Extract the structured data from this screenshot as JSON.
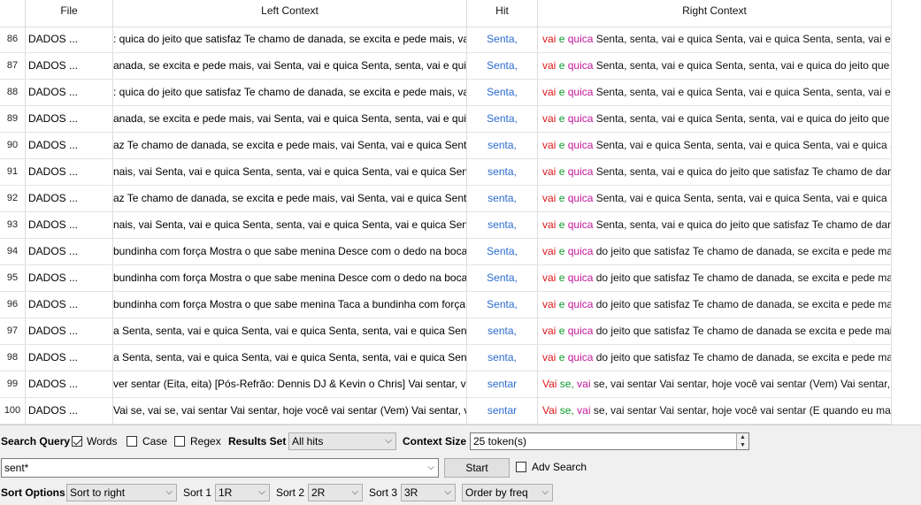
{
  "columns": {
    "file": "File",
    "left": "Left Context",
    "hit": "Hit",
    "right": "Right Context"
  },
  "rows": [
    {
      "num": "86",
      "file": "DADOS ...",
      "left": ": quica do jeito que satisfaz Te chamo de danada, se excita e pede mais, vai",
      "hit": "Senta,",
      "r1": "vai",
      "r2": "e",
      "r3": "quica",
      "rest": "Senta, senta, vai e quica Senta, vai e quica Senta, senta, vai e quica"
    },
    {
      "num": "87",
      "file": "DADOS ...",
      "left": "anada, se excita e pede mais, vai Senta, vai e quica Senta, senta, vai e quica",
      "hit": "Senta,",
      "r1": "vai",
      "r2": "e",
      "r3": "quica",
      "rest": "Senta, senta, vai e quica Senta, senta, vai e quica do jeito que satisfaz"
    },
    {
      "num": "88",
      "file": "DADOS ...",
      "left": ": quica do jeito que satisfaz Te chamo de danada, se excita e pede mais, vai",
      "hit": "Senta,",
      "r1": "vai",
      "r2": "e",
      "r3": "quica",
      "rest": "Senta, senta, vai e quica Senta, vai e quica Senta, senta, vai e quica"
    },
    {
      "num": "89",
      "file": "DADOS ...",
      "left": "anada, se excita e pede mais, vai Senta, vai e quica Senta, senta, vai e quica",
      "hit": "Senta,",
      "r1": "vai",
      "r2": "e",
      "r3": "quica",
      "rest": "Senta, senta, vai e quica Senta, senta, vai e quica do jeito que satisfaz"
    },
    {
      "num": "90",
      "file": "DADOS ...",
      "left": "az Te chamo de danada, se excita e pede mais, vai Senta, vai e quica Senta,",
      "hit": "senta,",
      "r1": "vai",
      "r2": "e",
      "r3": "quica",
      "rest": "Senta, vai e quica Senta, senta, vai e quica Senta, vai e quica Senta"
    },
    {
      "num": "91",
      "file": "DADOS ...",
      "left": "nais, vai Senta, vai e quica Senta, senta, vai e quica Senta, vai e quica Senta,",
      "hit": "senta,",
      "r1": "vai",
      "r2": "e",
      "r3": "quica",
      "rest": "Senta, senta, vai e quica do jeito que satisfaz Te chamo de danada"
    },
    {
      "num": "92",
      "file": "DADOS ...",
      "left": "az Te chamo de danada, se excita e pede mais, vai Senta, vai e quica Senta,",
      "hit": "senta,",
      "r1": "vai",
      "r2": "e",
      "r3": "quica",
      "rest": "Senta, vai e quica Senta, senta, vai e quica Senta, vai e quica Senta"
    },
    {
      "num": "93",
      "file": "DADOS ...",
      "left": "nais, vai Senta, vai e quica Senta, senta, vai e quica Senta, vai e quica Senta,",
      "hit": "senta,",
      "r1": "vai",
      "r2": "e",
      "r3": "quica",
      "rest": "Senta, senta, vai e quica do jeito que satisfaz Te chamo de danada"
    },
    {
      "num": "94",
      "file": "DADOS ...",
      "left": "bundinha com força Mostra o que sabe menina Desce com o dedo na boca",
      "hit": "Senta,",
      "r1": "vai",
      "r2": "e",
      "r3": "quica",
      "rest": "do jeito que satisfaz Te chamo de danada, se excita e pede mais, vai"
    },
    {
      "num": "95",
      "file": "DADOS ...",
      "left": "bundinha com força Mostra o que sabe menina Desce com o dedo na boca",
      "hit": "Senta,",
      "r1": "vai",
      "r2": "e",
      "r3": "quica",
      "rest": "do jeito que satisfaz Te chamo de danada, se excita e pede mais, vai"
    },
    {
      "num": "96",
      "file": "DADOS ...",
      "left": "bundinha com força Mostra o que sabe menina Taca a bundinha com força",
      "hit": "Senta,",
      "r1": "vai",
      "r2": "e",
      "r3": "quica",
      "rest": "do jeito que satisfaz Te chamo de danada, se excita e pede mais, vai"
    },
    {
      "num": "97",
      "file": "DADOS ...",
      "left": "a Senta, senta, vai e quica Senta, vai e quica Senta, senta, vai e quica Senta,",
      "hit": "senta,",
      "r1": "vai",
      "r2": "e",
      "r3": "quica",
      "rest": "do jeito que satisfaz Te chamo de danada se excita e pede mais ["
    },
    {
      "num": "98",
      "file": "DADOS ...",
      "left": "a Senta, senta, vai e quica Senta, vai e quica Senta, senta, vai e quica Senta,",
      "hit": "senta,",
      "r1": "vai",
      "r2": "e",
      "r3": "quica",
      "rest": "do jeito que satisfaz Te chamo de danada, se excita e pede mais, vai"
    },
    {
      "num": "99",
      "file": "DADOS ...",
      "left": "ver sentar (Eita, eita) [Pós-Refrão: Dennis DJ & Kevin o Chris] Vai sentar, vai",
      "hit": "sentar",
      "r1": "Vai",
      "r2": "se,",
      "r3": "vai",
      "rest": "se, vai sentar Vai sentar, hoje você vai sentar (Vem) Vai sentar, vai"
    },
    {
      "num": "100",
      "file": "DADOS ...",
      "left": "Vai se, vai se, vai sentar Vai sentar, hoje você vai sentar (Vem) Vai sentar, vai",
      "hit": "sentar",
      "r1": "Vai",
      "r2": "se,",
      "r3": "vai",
      "rest": "se, vai sentar Vai sentar, hoje você vai sentar (E quando eu mandar"
    }
  ],
  "controls": {
    "search_query_label": "Search Query",
    "words_label": "Words",
    "words_checked": true,
    "case_label": "Case",
    "case_checked": false,
    "regex_label": "Regex",
    "regex_checked": false,
    "results_set_label": "Results Set",
    "results_set_value": "All hits",
    "context_size_label": "Context Size",
    "context_size_value": "25 token(s)",
    "query_value": "sent*",
    "start_label": "Start",
    "adv_search_label": "Adv Search",
    "adv_search_checked": false,
    "sort_options_label": "Sort Options",
    "sort_mode_value": "Sort to right",
    "sort1_label": "Sort 1",
    "sort1_value": "1R",
    "sort2_label": "Sort 2",
    "sort2_value": "2R",
    "sort3_label": "Sort 3",
    "sort3_value": "3R",
    "order_value": "Order by freq"
  }
}
